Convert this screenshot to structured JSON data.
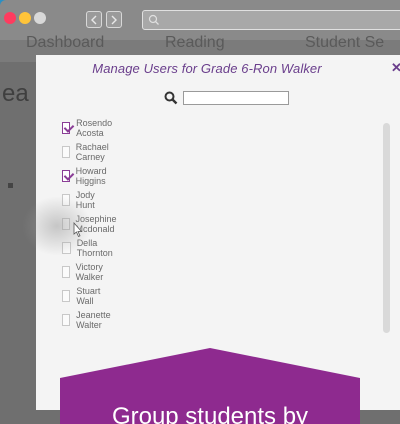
{
  "browser": {
    "colors": {
      "close": "#ff3b5f",
      "minimize": "#ffc43a",
      "maximize": "#d8d8d8"
    }
  },
  "app": {
    "nav": [
      "Dashboard",
      "Reading",
      "Student Se"
    ],
    "heading_fragment": "ea"
  },
  "modal": {
    "title": "Manage Users for Grade 6-Ron Walker",
    "close_label": "✕",
    "search": {
      "value": "",
      "placeholder": ""
    },
    "users": [
      {
        "name": "Rosendo Acosta",
        "checked": true
      },
      {
        "name": "Rachael Carney",
        "checked": false
      },
      {
        "name": "Howard Higgins",
        "checked": true
      },
      {
        "name": "Jody Hunt",
        "checked": false
      },
      {
        "name": "Josephine Mcdonald",
        "checked": false
      },
      {
        "name": "Della Thornton",
        "checked": false
      },
      {
        "name": "Victory Walker",
        "checked": false
      },
      {
        "name": "Stuart Wall",
        "checked": false
      },
      {
        "name": "Jeanette Walter",
        "checked": false
      }
    ]
  },
  "banner": {
    "text": "Group students by",
    "color": "#8e2a8f"
  }
}
